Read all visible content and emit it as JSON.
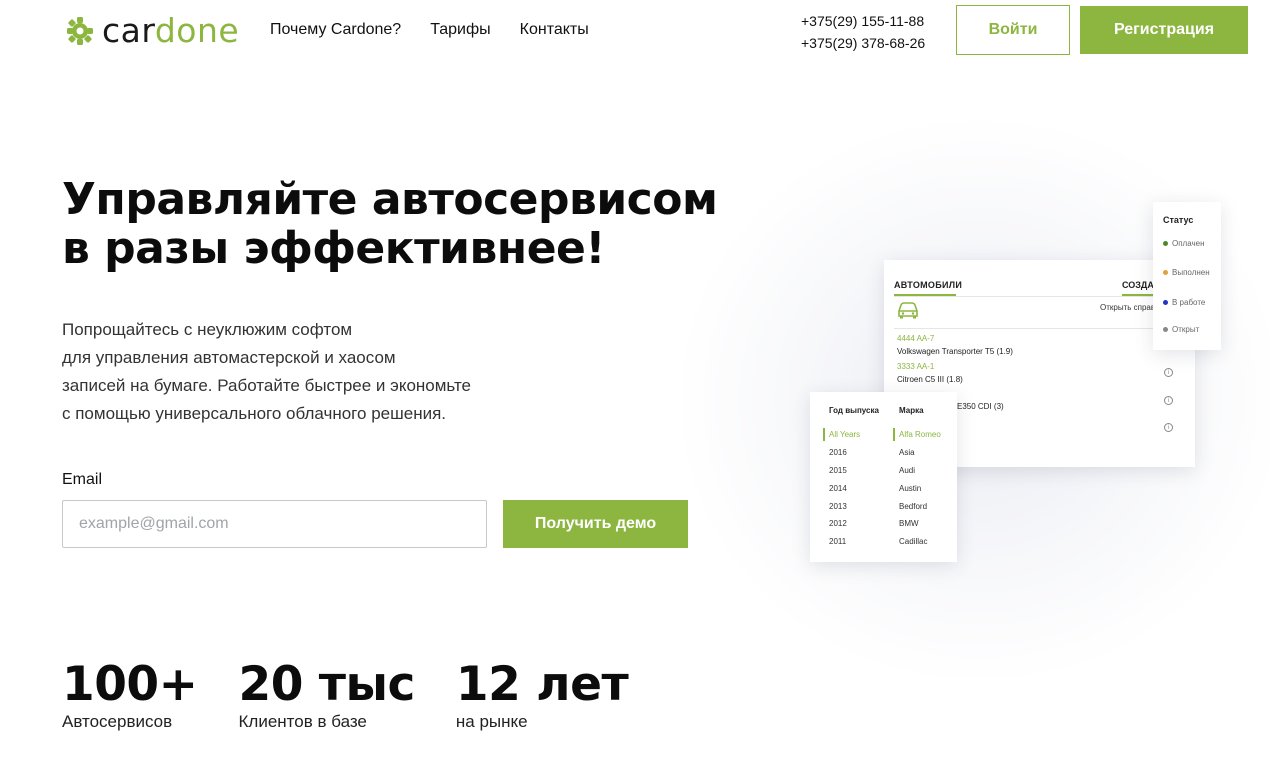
{
  "header": {
    "logo": {
      "part1": "car",
      "part2": "done"
    },
    "nav": [
      "Почему Cardone?",
      "Тарифы",
      "Контакты"
    ],
    "phones": [
      "+375(29) 155-11-88",
      "+375(29) 378-68-26"
    ],
    "login_label": "Войти",
    "register_label": "Регистрация"
  },
  "hero": {
    "title_lines": [
      "Управляйте автосервисом",
      "в разы эффективнее!"
    ],
    "description_lines": [
      "Попрощайтесь с неуклюжим софтом",
      "для управления автомастерской и хаосом",
      "записей на бумаге. Работайте быстрее и экономьте",
      "с помощью универсального облачного решения."
    ],
    "email_label": "Email",
    "email_placeholder": "example@gmail.com",
    "email_value": "",
    "demo_button_label": "Получить демо"
  },
  "stats": [
    {
      "value": "100+",
      "label": "Автосервисов"
    },
    {
      "value": "20 тыс",
      "label": "Клиентов в базе"
    },
    {
      "value": "12 лет",
      "label": "на рынке"
    }
  ],
  "mockup": {
    "cars_tab": "АВТОМОБИЛИ",
    "create_tab": "СОЗДАТ",
    "open_ref": "Открыть справ",
    "cars": [
      {
        "plate": "4444 AA-7",
        "model": "Volkswagen Transporter T5 (1.9)"
      },
      {
        "plate": "3333 AA-1",
        "model": "Citroen C5 III (1.8)"
      },
      {
        "plate": "",
        "model": "E350 CDI (3)"
      }
    ],
    "status_title": "Статус",
    "statuses": [
      {
        "label": "Оплачен",
        "color": "#4a8a2a"
      },
      {
        "label": "Выполнен",
        "color": "#e0a23a"
      },
      {
        "label": "В работе",
        "color": "#2233cc"
      },
      {
        "label": "Открыт",
        "color": "#888888"
      }
    ],
    "filter_year_header": "Год выпуска",
    "filter_brand_header": "Марка",
    "years": [
      "All Years",
      "2016",
      "2015",
      "2014",
      "2013",
      "2012",
      "2011"
    ],
    "brands": [
      "Alfa Romeo",
      "Asia",
      "Audi",
      "Austin",
      "Bedford",
      "BMW",
      "Cadillac"
    ]
  },
  "colors": {
    "accent": "#8db640",
    "text": "#111111"
  }
}
